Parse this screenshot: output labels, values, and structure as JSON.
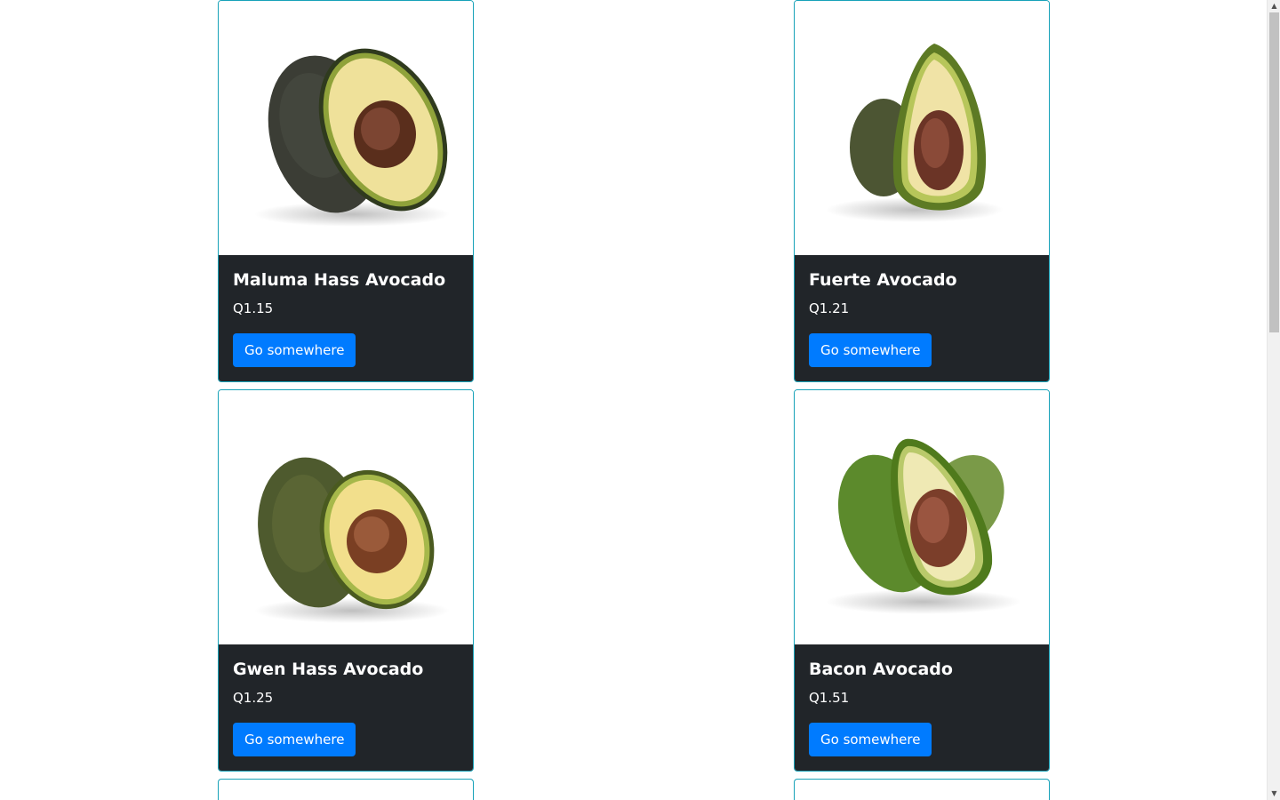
{
  "colors": {
    "card_border": "#17a2b8",
    "card_body_bg": "#212529",
    "button_bg": "#007bff",
    "text_light": "#ffffff"
  },
  "products": [
    {
      "name": "Maluma Hass Avocado",
      "price": "Q1.15",
      "button_label": "Go somewhere",
      "image_icon": "avocado-half-image"
    },
    {
      "name": "Fuerte Avocado",
      "price": "Q1.21",
      "button_label": "Go somewhere",
      "image_icon": "avocado-half-image"
    },
    {
      "name": "Gwen Hass Avocado",
      "price": "Q1.25",
      "button_label": "Go somewhere",
      "image_icon": "avocado-half-image"
    },
    {
      "name": "Bacon Avocado",
      "price": "Q1.51",
      "button_label": "Go somewhere",
      "image_icon": "avocado-half-image"
    }
  ]
}
